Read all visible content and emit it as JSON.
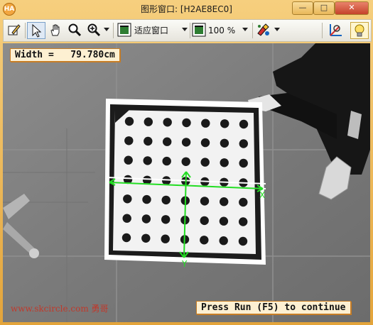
{
  "window": {
    "title": "图形窗口: [H2AE8EC0]",
    "app_icon_text": "HA",
    "controls": {
      "minimize": "—",
      "maximize": "□",
      "close": "✕"
    }
  },
  "toolbar": {
    "zoom_mode_label": "适应窗口",
    "zoom_percent_label": "100 %",
    "icons": [
      "edit-icon",
      "pointer-icon",
      "hand-icon",
      "magnifier-icon",
      "zoom-in-icon",
      "fit-window-icon",
      "zoom-percent-icon",
      "color-settings-icon",
      "pixel-info-icon",
      "lightbulb-icon"
    ]
  },
  "overlay": {
    "measurement": "Width =   79.780cm",
    "status_prompt": "Press Run (F5) to continue",
    "axis_x_label": "X",
    "axis_y_label": "Y"
  },
  "watermark": "www.skcircle.com 勇哥",
  "colors": {
    "frame": "#e8b04a",
    "axis": "#22dd22",
    "badge_bg": "#fdf0d2",
    "badge_border": "#c77d25",
    "watermark": "#c0392b"
  },
  "calibration_grid": {
    "rows": 7,
    "cols": 7
  }
}
